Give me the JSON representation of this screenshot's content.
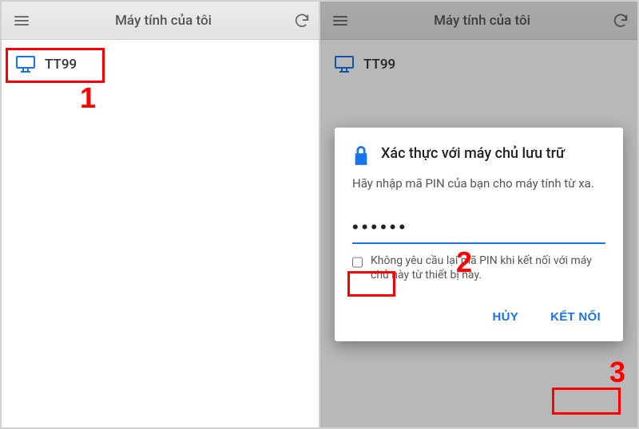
{
  "left": {
    "appbar_title": "Máy tính của tôi",
    "host_name": "TT99",
    "annotation": "1"
  },
  "right": {
    "appbar_title": "Máy tính của tôi",
    "host_name": "TT99",
    "dialog": {
      "title": "Xác thực với máy chủ lưu trữ",
      "message": "Hãy nhập mã PIN của bạn cho máy tính từ xa.",
      "pin_value": "••••••",
      "checkbox_label": "Không yêu cầu lại mã PIN khi kết nối với máy chủ này từ thiết bị này.",
      "cancel_label": "HỦY",
      "connect_label": "KẾT NỐI"
    },
    "annotation_pin": "2",
    "annotation_connect": "3"
  }
}
